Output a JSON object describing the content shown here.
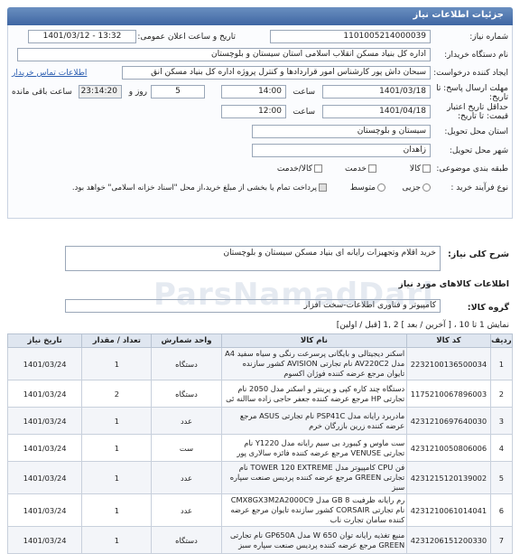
{
  "header": {
    "title": "جزئیات اطلاعات نیاز"
  },
  "fields": {
    "need_number_label": "شماره نیاز:",
    "need_number": "1101005214000039",
    "announce_label": "تاریخ و ساعت اعلان عمومی:",
    "announce_value": "1401/03/12 - 13:32",
    "buyer_org_label": "نام دستگاه خریدار:",
    "buyer_org": "اداره کل بنیاد مسکن انقلاب اسلامی استان سیستان و بلوچستان",
    "creator_label": "ایجاد کننده درخواست:",
    "creator": "سبحان داش پور کارشناس امور قراردادها و کنترل پروژه اداره کل بنیاد مسکن انق",
    "contact_link": "اطلاعات تماس خریدار",
    "reply_deadline_label": "مهلت ارسال پاسخ: تا تاریخ:",
    "reply_date": "1401/03/18",
    "time_label": "ساعت",
    "reply_time": "14:00",
    "days": "5",
    "days_label": "روز و",
    "remaining": "23:14:20",
    "remaining_label": "ساعت باقی مانده",
    "validity_label": "حداقل تاریخ اعتبار قیمت: تا تاریخ:",
    "validity_date": "1401/04/18",
    "validity_time_label": "ساعت",
    "validity_time": "12:00",
    "province_label": "استان محل تحویل:",
    "province": "سیستان و بلوچستان",
    "city_label": "شهر محل تحویل:",
    "city": "زاهدان",
    "category_label": "طبقه بندی موضوعی:",
    "cat_goods": "کالا",
    "cat_service": "خدمت",
    "cat_both": "کالا/خدمت",
    "purchase_type_label": "نوع فرآیند خرید :",
    "pt_partial": "جزیی",
    "pt_medium": "متوسط",
    "payment_note": "پرداخت تمام یا بخشی از مبلغ خرید،از محل \"اسناد خزانه اسلامی\" خواهد بود."
  },
  "description": {
    "label": "شرح کلی نیاز:",
    "value": "خرید اقلام وتجهیزات رایانه ای بنیاد مسکن سیستان و بلوچستان"
  },
  "goods_info": {
    "title": "اطلاعات کالاهای مورد نیاز"
  },
  "goods_group": {
    "label": "گروه کالا:",
    "value": "کامپیوتر و فناوری اطلاعات-سخت افزار"
  },
  "pagination": {
    "text": "نمایش 1 تا 10 ، [ آخرین / بعد ] 2 ,1 [قبل / اولین]"
  },
  "watermark": "ParsNamadDari",
  "table": {
    "headers": [
      "ردیف",
      "کد کالا",
      "نام کالا",
      "واحد شمارش",
      "تعداد / مقدار",
      "تاریخ نیاز"
    ],
    "rows": [
      {
        "n": "1",
        "code": "2232100136500034",
        "name": "اسکنر دیجیتالی و بایگانی پرسرعت رنگی و سیاه سفید A4 مدل AV220C2 نام تجارتی AVISION کشور سازنده تایوان مرجع عرضه کننده فوژان اکسوم",
        "unit": "دستگاه",
        "qty": "1",
        "date": "1401/03/24"
      },
      {
        "n": "2",
        "code": "1175210067896003",
        "name": "دستگاه چند کاره کپی و پرینتر و اسکنر مدل 2050 نام تجارتی HP مرجع عرضه کننده جعفر حاجی زاده ساالنه ئی",
        "unit": "دستگاه",
        "qty": "2",
        "date": "1401/03/24"
      },
      {
        "n": "3",
        "code": "4231210697640030",
        "name": "مادربرد رایانه مدل PSP41C نام تجارتی ASUS مرجع عرضه کننده زرین بازرگان خرم",
        "unit": "عدد",
        "qty": "1",
        "date": "1401/03/24"
      },
      {
        "n": "4",
        "code": "4231210050806006",
        "name": "ست ماوس و کیبورد بی سیم رایانه مدل Y1220 نام تجارتی VENUSE مرجع عرضه کننده فائزه سالاری پور",
        "unit": "ست",
        "qty": "1",
        "date": "1401/03/24"
      },
      {
        "n": "5",
        "code": "4231215120139002",
        "name": "فن CPU کامپیوتر مدل TOWER 120 EXTREME نام تجارتی GREEN مرجع عرضه کننده پردیس صنعت سپاره سبز",
        "unit": "عدد",
        "qty": "1",
        "date": "1401/03/24"
      },
      {
        "n": "6",
        "code": "4231210061014041",
        "name": "رم رایانه ظرفیت 8 GB مدل CMX8GX3M2A2000C9 نام تجارتی CORSAIR کشور سازنده تایوان مرجع عرضه کننده سامان تجارت ناب",
        "unit": "عدد",
        "qty": "1",
        "date": "1401/03/24"
      },
      {
        "n": "7",
        "code": "4231206151200330",
        "name": "منبع تغذیه رایانه توان 650 W مدل GP650A نام تجارتی GREEN مرجع عرضه کننده پردیس صنعت سپاره سبز",
        "unit": "دستگاه",
        "qty": "1",
        "date": "1401/03/24"
      }
    ]
  }
}
